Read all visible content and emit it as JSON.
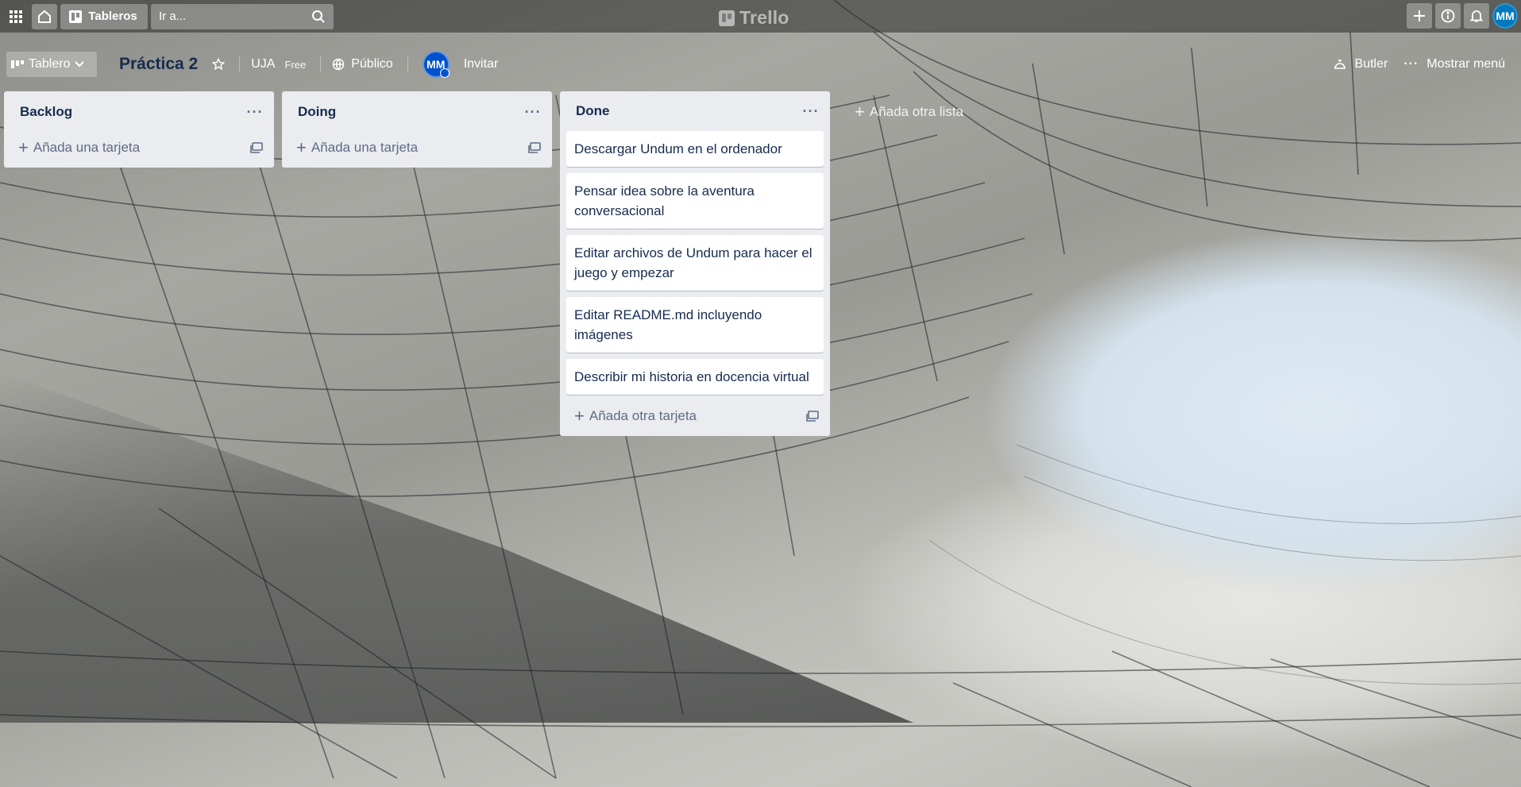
{
  "header": {
    "boards_label": "Tableros",
    "search_placeholder": "Ir a...",
    "logo_text": "Trello",
    "avatar_initials": "MM"
  },
  "board": {
    "view_label": "Tablero",
    "title": "Práctica 2",
    "team": "UJA",
    "plan": "Free",
    "visibility": "Público",
    "member_initials": "MM",
    "invite_label": "Invitar",
    "butler_label": "Butler",
    "menu_label": "Mostrar menú"
  },
  "lists": [
    {
      "title": "Backlog",
      "cards": [],
      "add_label": "Añada una tarjeta"
    },
    {
      "title": "Doing",
      "cards": [],
      "add_label": "Añada una tarjeta"
    },
    {
      "title": "Done",
      "cards": [
        "Descargar Undum en el ordenador",
        "Pensar idea sobre la aventura conversacional",
        "Editar archivos de Undum para hacer el juego y empezar",
        "Editar README.md incluyendo imágenes",
        "Describir mi historia en docencia virtual"
      ],
      "add_label": "Añada otra tarjeta"
    }
  ],
  "add_list_label": "Añada otra lista",
  "colors": {
    "list_bg": "#ebecf0",
    "text": "#172b4d",
    "avatar": "#0079bf"
  }
}
